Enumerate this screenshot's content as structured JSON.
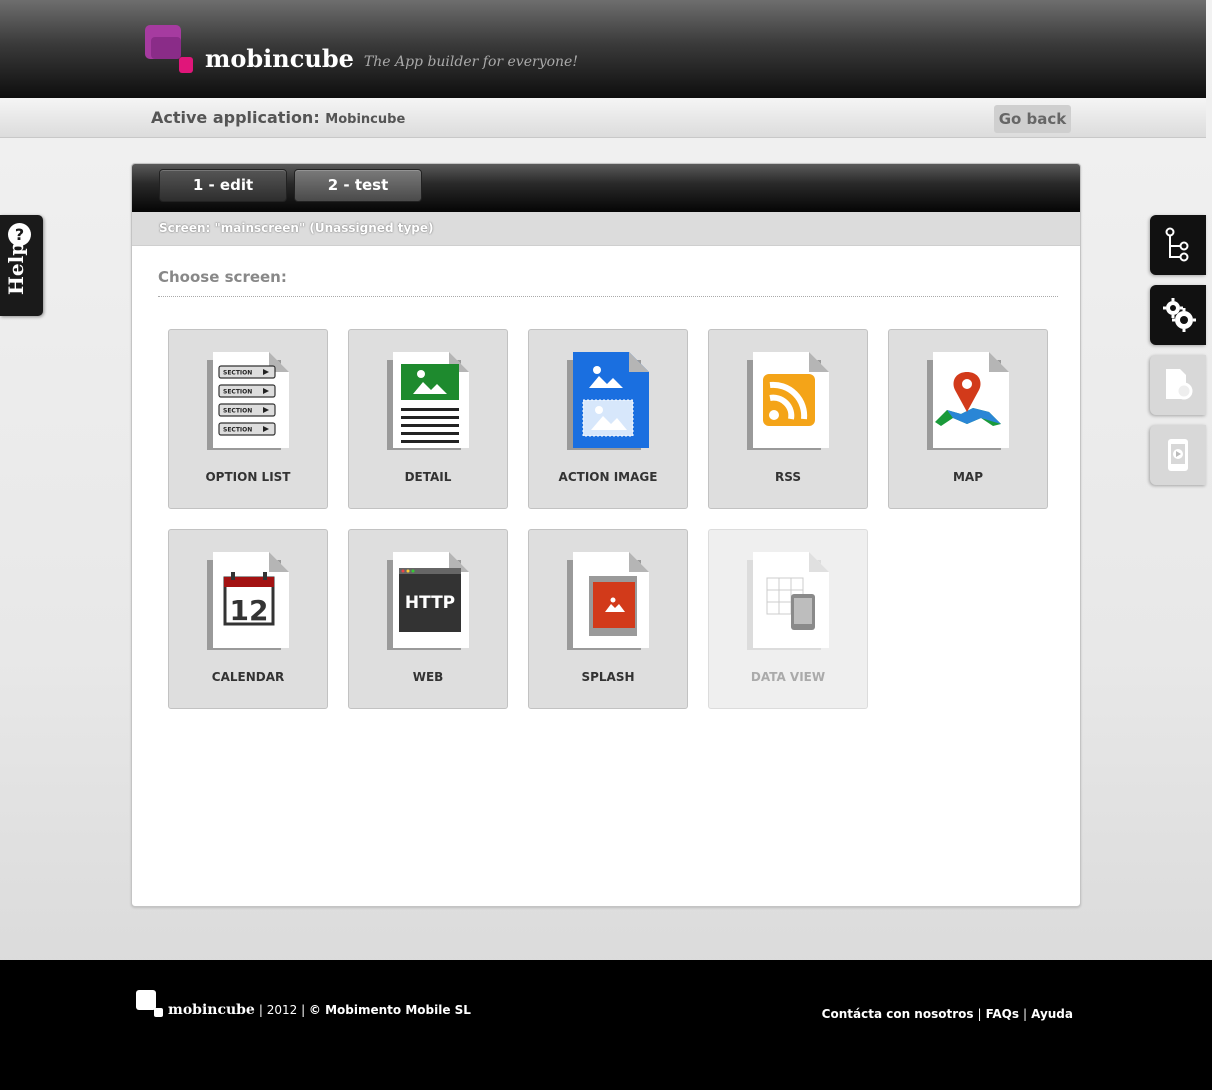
{
  "header": {
    "brand": "mobincube",
    "tagline": "The App builder for everyone!"
  },
  "appbar": {
    "label": "Active application:",
    "app_name": "Mobincube",
    "go_back": "Go back"
  },
  "tabs": [
    "1 - edit",
    "2 - test"
  ],
  "screen_info": "Screen: \"mainscreen\" (Unassigned type)",
  "choose_label": "Choose screen:",
  "screen_types": [
    {
      "label": "OPTION LIST",
      "icon": "option-list-icon",
      "enabled": true
    },
    {
      "label": "DETAIL",
      "icon": "detail-icon",
      "enabled": true
    },
    {
      "label": "ACTION IMAGE",
      "icon": "action-image-icon",
      "enabled": true
    },
    {
      "label": "RSS",
      "icon": "rss-icon",
      "enabled": true
    },
    {
      "label": "MAP",
      "icon": "map-icon",
      "enabled": true
    },
    {
      "label": "CALENDAR",
      "icon": "calendar-icon",
      "enabled": true
    },
    {
      "label": "WEB",
      "icon": "web-icon",
      "enabled": true
    },
    {
      "label": "SPLASH",
      "icon": "splash-icon",
      "enabled": true
    },
    {
      "label": "DATA VIEW",
      "icon": "data-view-icon",
      "enabled": false
    }
  ],
  "icon_text": {
    "section": "SECTION",
    "calendar_day": "12",
    "http": "HTTP"
  },
  "help": {
    "label": "Help",
    "icon_glyph": "?"
  },
  "side_tools": [
    {
      "icon": "tree-structure-icon",
      "active": true
    },
    {
      "icon": "settings-gears-icon",
      "active": true
    },
    {
      "icon": "document-settings-icon",
      "active": false
    },
    {
      "icon": "mobile-preview-icon",
      "active": false
    }
  ],
  "footer": {
    "brand": "mobincube",
    "year": "2012",
    "copyright": "© Mobimento Mobile SL",
    "links": [
      "Contácta con nosotros",
      "FAQs",
      "Ayuda"
    ]
  },
  "colors": {
    "brand_purple": "#a63ba0",
    "brand_pink": "#e0167a",
    "header_dark": "#0e0e0e",
    "card_bg": "#dedede"
  }
}
